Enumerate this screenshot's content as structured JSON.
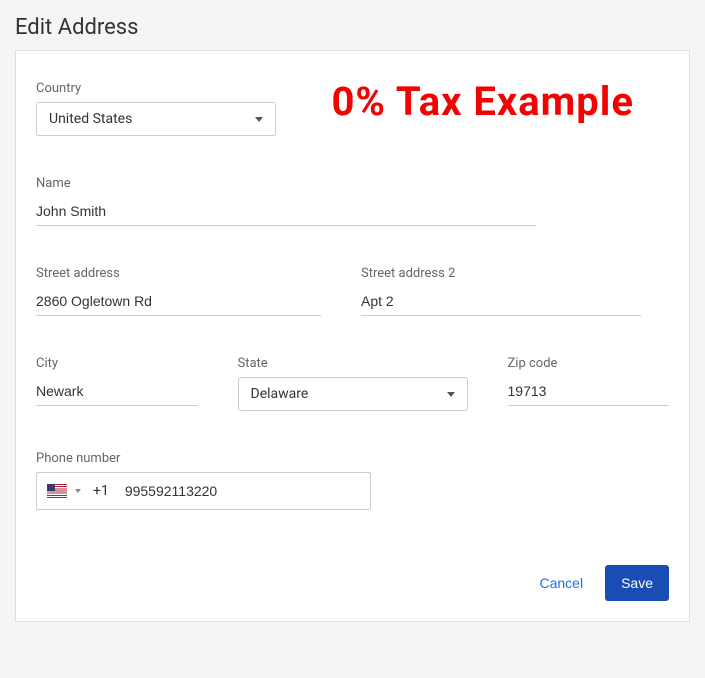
{
  "page": {
    "title": "Edit Address"
  },
  "overlay": {
    "text": "0% Tax Example"
  },
  "form": {
    "country": {
      "label": "Country",
      "value": "United States"
    },
    "name": {
      "label": "Name",
      "value": "John Smith"
    },
    "street": {
      "label": "Street address",
      "value": "2860 Ogletown Rd"
    },
    "street2": {
      "label": "Street address 2",
      "value": "Apt 2"
    },
    "city": {
      "label": "City",
      "value": "Newark"
    },
    "state": {
      "label": "State",
      "value": "Delaware"
    },
    "zip": {
      "label": "Zip code",
      "value": "19713"
    },
    "phone": {
      "label": "Phone number",
      "prefix": "+1",
      "value": "995592113220"
    }
  },
  "actions": {
    "cancel": "Cancel",
    "save": "Save"
  }
}
